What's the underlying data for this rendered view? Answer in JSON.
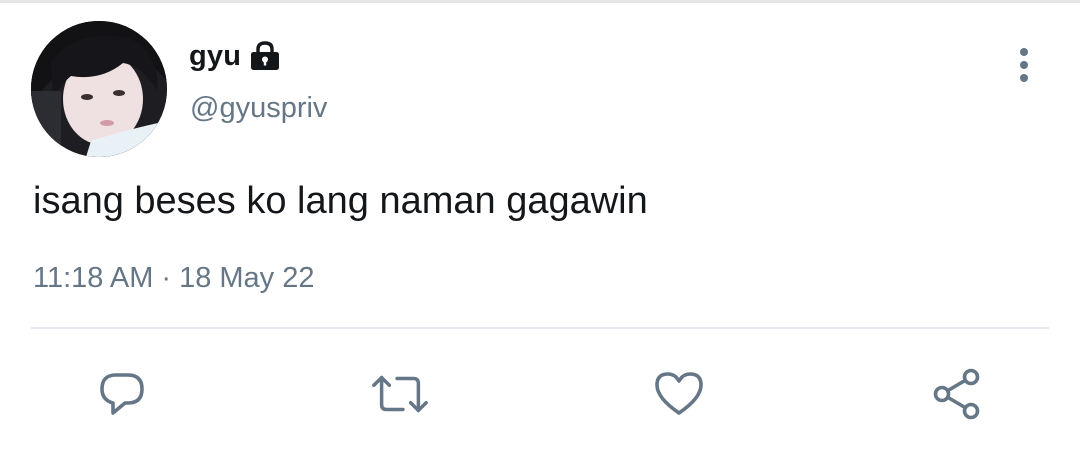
{
  "tweet": {
    "author": {
      "display_name": "gyu",
      "handle": "@gyuspriv",
      "protected_icon": "lock-icon",
      "avatar": "profile-photo"
    },
    "text": "isang beses ko lang naman gagawin",
    "time": "11:18 AM",
    "separator": "·",
    "date": "18 May 22"
  },
  "header": {
    "menu_icon": "more-vertical-icon"
  },
  "actions": [
    {
      "name": "reply",
      "icon": "reply-icon"
    },
    {
      "name": "retweet",
      "icon": "retweet-icon"
    },
    {
      "name": "like",
      "icon": "heart-icon"
    },
    {
      "name": "share",
      "icon": "share-icon"
    }
  ],
  "colors": {
    "text_primary": "#14171a",
    "text_secondary": "#657786",
    "divider": "#e6ecf0",
    "background": "#ffffff"
  }
}
